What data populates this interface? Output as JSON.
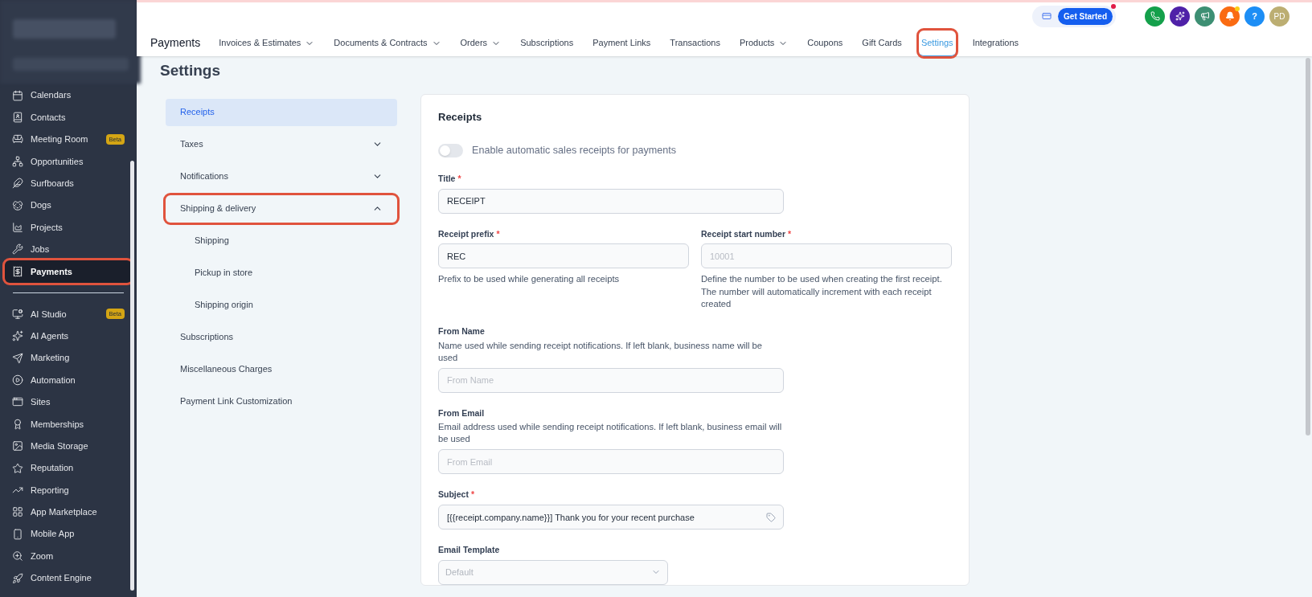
{
  "sidebar": {
    "items": [
      {
        "label": "Calendars",
        "selected": false,
        "highlighted": false
      },
      {
        "label": "Contacts",
        "selected": false,
        "highlighted": false
      },
      {
        "label": "Meeting Room",
        "selected": false,
        "highlighted": false,
        "badge": "Beta"
      },
      {
        "label": "Opportunities",
        "selected": false,
        "highlighted": false
      },
      {
        "label": "Surfboards",
        "selected": false,
        "highlighted": false
      },
      {
        "label": "Dogs",
        "selected": false,
        "highlighted": false
      },
      {
        "label": "Projects",
        "selected": false,
        "highlighted": false
      },
      {
        "label": "Jobs",
        "selected": false,
        "highlighted": false
      },
      {
        "label": "Payments",
        "selected": true,
        "highlighted": true
      },
      {
        "kind": "divider"
      },
      {
        "label": "AI Studio",
        "selected": false,
        "highlighted": false,
        "badge": "Beta"
      },
      {
        "label": "AI Agents",
        "selected": false,
        "highlighted": false
      },
      {
        "label": "Marketing",
        "selected": false,
        "highlighted": false
      },
      {
        "label": "Automation",
        "selected": false,
        "highlighted": false
      },
      {
        "label": "Sites",
        "selected": false,
        "highlighted": false
      },
      {
        "label": "Memberships",
        "selected": false,
        "highlighted": false
      },
      {
        "label": "Media Storage",
        "selected": false,
        "highlighted": false
      },
      {
        "label": "Reputation",
        "selected": false,
        "highlighted": false
      },
      {
        "label": "Reporting",
        "selected": false,
        "highlighted": false
      },
      {
        "label": "App Marketplace",
        "selected": false,
        "highlighted": false
      },
      {
        "label": "Mobile App",
        "selected": false,
        "highlighted": false
      },
      {
        "label": "Zoom",
        "selected": false,
        "highlighted": false
      },
      {
        "label": "Content Engine",
        "selected": false,
        "highlighted": false
      }
    ]
  },
  "header": {
    "get_started": "Get Started",
    "help": "?",
    "avatar": "PD"
  },
  "nav": {
    "title": "Payments",
    "tabs": [
      {
        "label": "Invoices & Estimates",
        "has_menu": true,
        "selected": false,
        "highlighted": false
      },
      {
        "label": "Documents & Contracts",
        "has_menu": true,
        "selected": false,
        "highlighted": false
      },
      {
        "label": "Orders",
        "has_menu": true,
        "selected": false,
        "highlighted": false
      },
      {
        "label": "Subscriptions",
        "has_menu": false,
        "selected": false,
        "highlighted": false
      },
      {
        "label": "Payment Links",
        "has_menu": false,
        "selected": false,
        "highlighted": false
      },
      {
        "label": "Transactions",
        "has_menu": false,
        "selected": false,
        "highlighted": false
      },
      {
        "label": "Products",
        "has_menu": true,
        "selected": false,
        "highlighted": false
      },
      {
        "label": "Coupons",
        "has_menu": false,
        "selected": false,
        "highlighted": false
      },
      {
        "label": "Gift Cards",
        "has_menu": false,
        "selected": false,
        "highlighted": false
      },
      {
        "label": "Settings",
        "has_menu": false,
        "selected": true,
        "highlighted": true
      },
      {
        "label": "Integrations",
        "has_menu": false,
        "selected": false,
        "highlighted": false
      }
    ]
  },
  "page_title": "Settings",
  "settings_menu": [
    {
      "label": "Receipts",
      "kind": "link",
      "selected": true,
      "highlighted": false
    },
    {
      "label": "Taxes",
      "kind": "group",
      "expanded": false,
      "selected": false,
      "highlighted": false
    },
    {
      "label": "Notifications",
      "kind": "group",
      "expanded": false,
      "selected": false,
      "highlighted": false
    },
    {
      "label": "Shipping & delivery",
      "kind": "group",
      "expanded": true,
      "selected": false,
      "highlighted": true,
      "children": [
        {
          "label": "Shipping",
          "selected": false
        },
        {
          "label": "Pickup in store",
          "selected": false
        },
        {
          "label": "Shipping origin",
          "selected": false
        }
      ]
    },
    {
      "label": "Subscriptions",
      "kind": "link",
      "selected": false,
      "highlighted": false
    },
    {
      "label": "Miscellaneous Charges",
      "kind": "link",
      "selected": false,
      "highlighted": false
    },
    {
      "label": "Payment Link Customization",
      "kind": "link",
      "selected": false,
      "highlighted": false
    }
  ],
  "card": {
    "title": "Receipts",
    "toggle": {
      "label": "Enable automatic sales receipts for payments",
      "on": false
    },
    "rows": [
      {
        "fields": [
          {
            "kind": "text",
            "label": "Title",
            "required_mark": "*",
            "value": "RECEIPT"
          }
        ]
      },
      {
        "fields": [
          {
            "kind": "text",
            "label": "Receipt prefix",
            "required_mark": "*",
            "value": "REC",
            "help": "Prefix to be used while generating all receipts"
          },
          {
            "kind": "text",
            "label": "Receipt start number",
            "required_mark": "*",
            "placeholder": "10001",
            "help": "Define the number to be used when creating the first receipt. The number will automatically increment with each receipt created"
          }
        ]
      },
      {
        "fields": [
          {
            "kind": "text",
            "label": "From Name",
            "description": "Name used while sending receipt notifications. If left blank, business name will be used",
            "placeholder": "From Name"
          }
        ]
      },
      {
        "fields": [
          {
            "kind": "text",
            "label": "From Email",
            "description": "Email address used while sending receipt notifications. If left blank, business email will be used",
            "placeholder": "From Email"
          }
        ]
      },
      {
        "fields": [
          {
            "kind": "tag-text",
            "label": "Subject",
            "required_mark": "*",
            "value": "[{{receipt.company.name}}] Thank you for your recent purchase"
          }
        ]
      },
      {
        "fields": [
          {
            "kind": "select",
            "label": "Email Template",
            "placeholder": "Default"
          }
        ]
      }
    ]
  }
}
